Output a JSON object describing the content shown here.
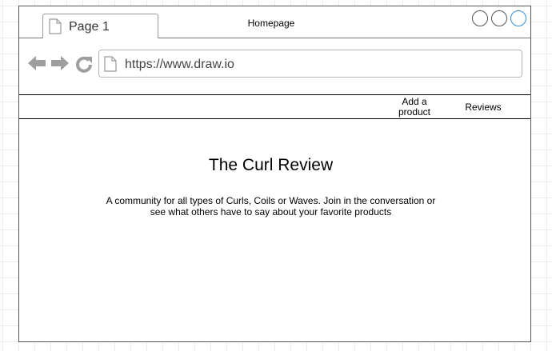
{
  "browser": {
    "tab": {
      "label": "Page 1",
      "icon": "page-icon"
    },
    "window_title": "Homepage",
    "window_buttons": [
      "circle-button",
      "circle-button",
      "circle-button-active"
    ],
    "window_button_accent": "#3a8ed8",
    "nav": {
      "back_icon": "back-arrow-icon",
      "forward_icon": "forward-arrow-icon",
      "reload_icon": "reload-icon"
    },
    "url": "https://www.draw.io"
  },
  "menu": {
    "add_product_line1": "Add a",
    "add_product_line2": "product",
    "reviews": "Reviews"
  },
  "content": {
    "title": "The Curl Review",
    "description_line1": "A community for all types of Curls, Coils or Waves. Join in the conversation or",
    "description_line2": "see what others have to say about your favorite products"
  }
}
